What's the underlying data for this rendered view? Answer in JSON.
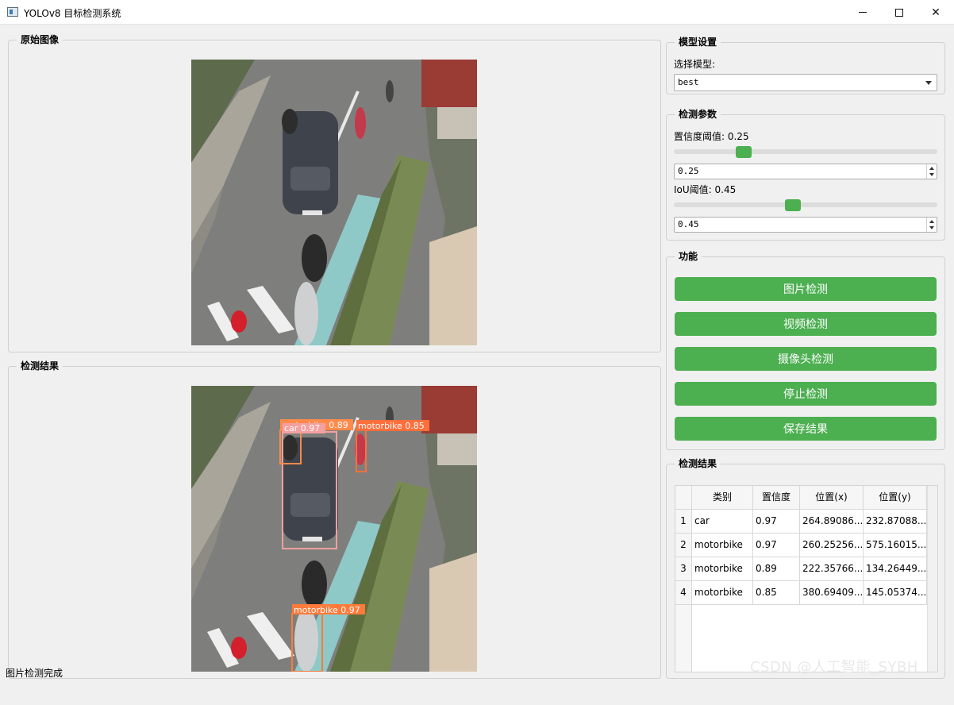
{
  "window": {
    "title": "YOLOv8 目标检测系统"
  },
  "original_panel": {
    "title": "原始图像"
  },
  "result_panel": {
    "title": "检测结果",
    "detections": [
      {
        "label": "car 0.97",
        "color": "#f4a0a0"
      },
      {
        "label": "motorbike 0.89",
        "color": "#ff8a4a"
      },
      {
        "label": "motorbike 0.85",
        "color": "#ff6f3c"
      },
      {
        "label": "motorbike 0.97",
        "color": "#ff7a3a"
      }
    ]
  },
  "model_settings": {
    "title": "模型设置",
    "select_label": "选择模型:",
    "selected_model": "best"
  },
  "detect_params": {
    "title": "检测参数",
    "confidence_label": "置信度阈值: 0.25",
    "confidence_value": "0.25",
    "confidence_fraction": 0.25,
    "iou_label": "IoU阈值: 0.45",
    "iou_value": "0.45",
    "iou_fraction": 0.45
  },
  "functions": {
    "title": "功能",
    "buttons": [
      "图片检测",
      "视频检测",
      "摄像头检测",
      "停止检测",
      "保存结果"
    ],
    "button_color": "#4caf50"
  },
  "results_table": {
    "title": "检测结果",
    "columns": [
      "类别",
      "置信度",
      "位置(x)",
      "位置(y)"
    ],
    "rows": [
      {
        "index": "1",
        "cls": "car",
        "conf": "0.97",
        "x": "264.89086...",
        "y": "232.87088..."
      },
      {
        "index": "2",
        "cls": "motorbike",
        "conf": "0.97",
        "x": "260.25256...",
        "y": "575.16015..."
      },
      {
        "index": "3",
        "cls": "motorbike",
        "conf": "0.89",
        "x": "222.35766...",
        "y": "134.26449..."
      },
      {
        "index": "4",
        "cls": "motorbike",
        "conf": "0.85",
        "x": "380.69409...",
        "y": "145.05374..."
      }
    ]
  },
  "status": {
    "text": "图片检测完成"
  },
  "watermark": "CSDN @人工智能_SYBH"
}
